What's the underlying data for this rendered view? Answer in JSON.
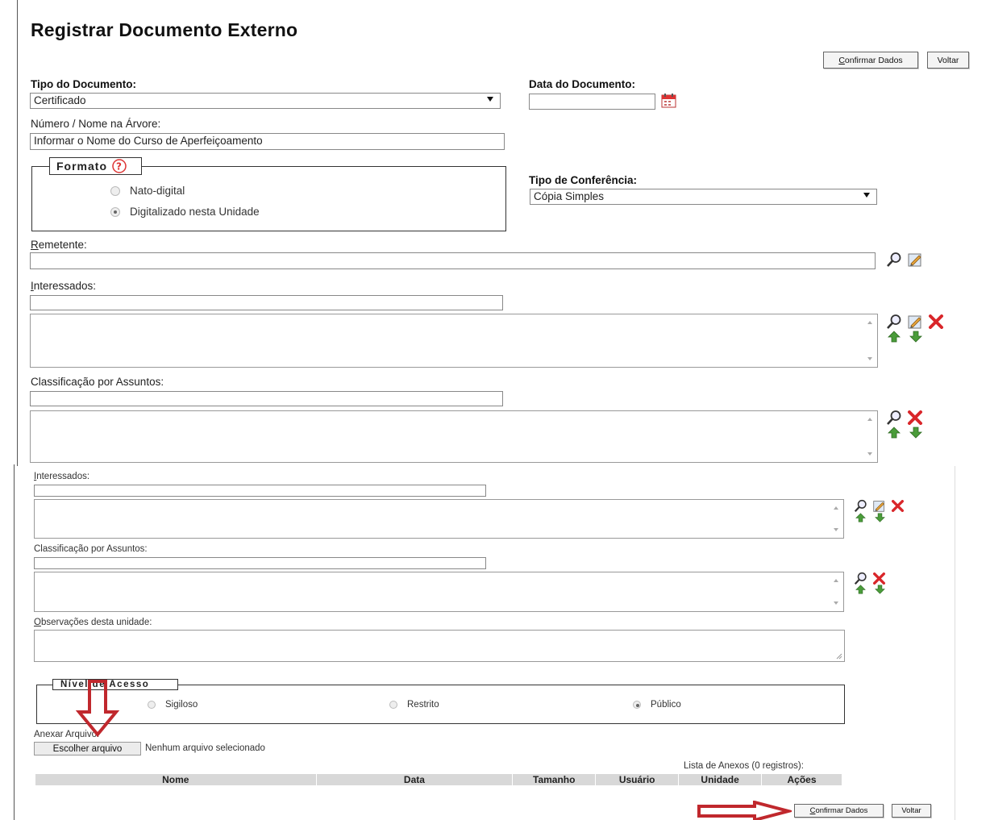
{
  "page": {
    "title": "Registrar Documento Externo",
    "buttons": {
      "confirm": "Confirmar Dados",
      "back": "Voltar"
    }
  },
  "form": {
    "tipo_documento": {
      "label": "Tipo do Documento:",
      "value": "Certificado"
    },
    "data_documento": {
      "label": "Data do Documento:",
      "value": ""
    },
    "numero_nome": {
      "label": "Número / Nome na Árvore:",
      "value": "Informar o Nome do Curso de Aperfeiçoamento"
    },
    "formato": {
      "legend": "Formato",
      "options": [
        {
          "label": "Nato-digital",
          "selected": false
        },
        {
          "label": "Digitalizado nesta Unidade",
          "selected": true
        }
      ]
    },
    "tipo_conferencia": {
      "label": "Tipo de Conferência:",
      "value": "Cópia Simples"
    },
    "remetente": {
      "label": "Remetente:"
    },
    "interessados": {
      "label": "Interessados:"
    },
    "classificacao": {
      "label": "Classificação por Assuntos:"
    },
    "observacoes": {
      "label": "Observações desta unidade:"
    },
    "nivel_acesso": {
      "legend": "Nível de Acesso",
      "options": [
        {
          "label": "Sigiloso",
          "selected": false
        },
        {
          "label": "Restrito",
          "selected": false
        },
        {
          "label": "Público",
          "selected": true
        }
      ]
    },
    "anexar": {
      "label": "Anexar Arquivo:",
      "button": "Escolher arquivo",
      "status": "Nenhum arquivo selecionado"
    },
    "anexos": {
      "caption": "Lista de Anexos (0 registros):",
      "columns": [
        "Nome",
        "Data",
        "Tamanho",
        "Usuário",
        "Unidade",
        "Ações"
      ]
    }
  },
  "colors": {
    "annotation_arrow": "#c0282d",
    "remove_icon": "#d9262a",
    "move_icon": "#4a9c3a"
  }
}
